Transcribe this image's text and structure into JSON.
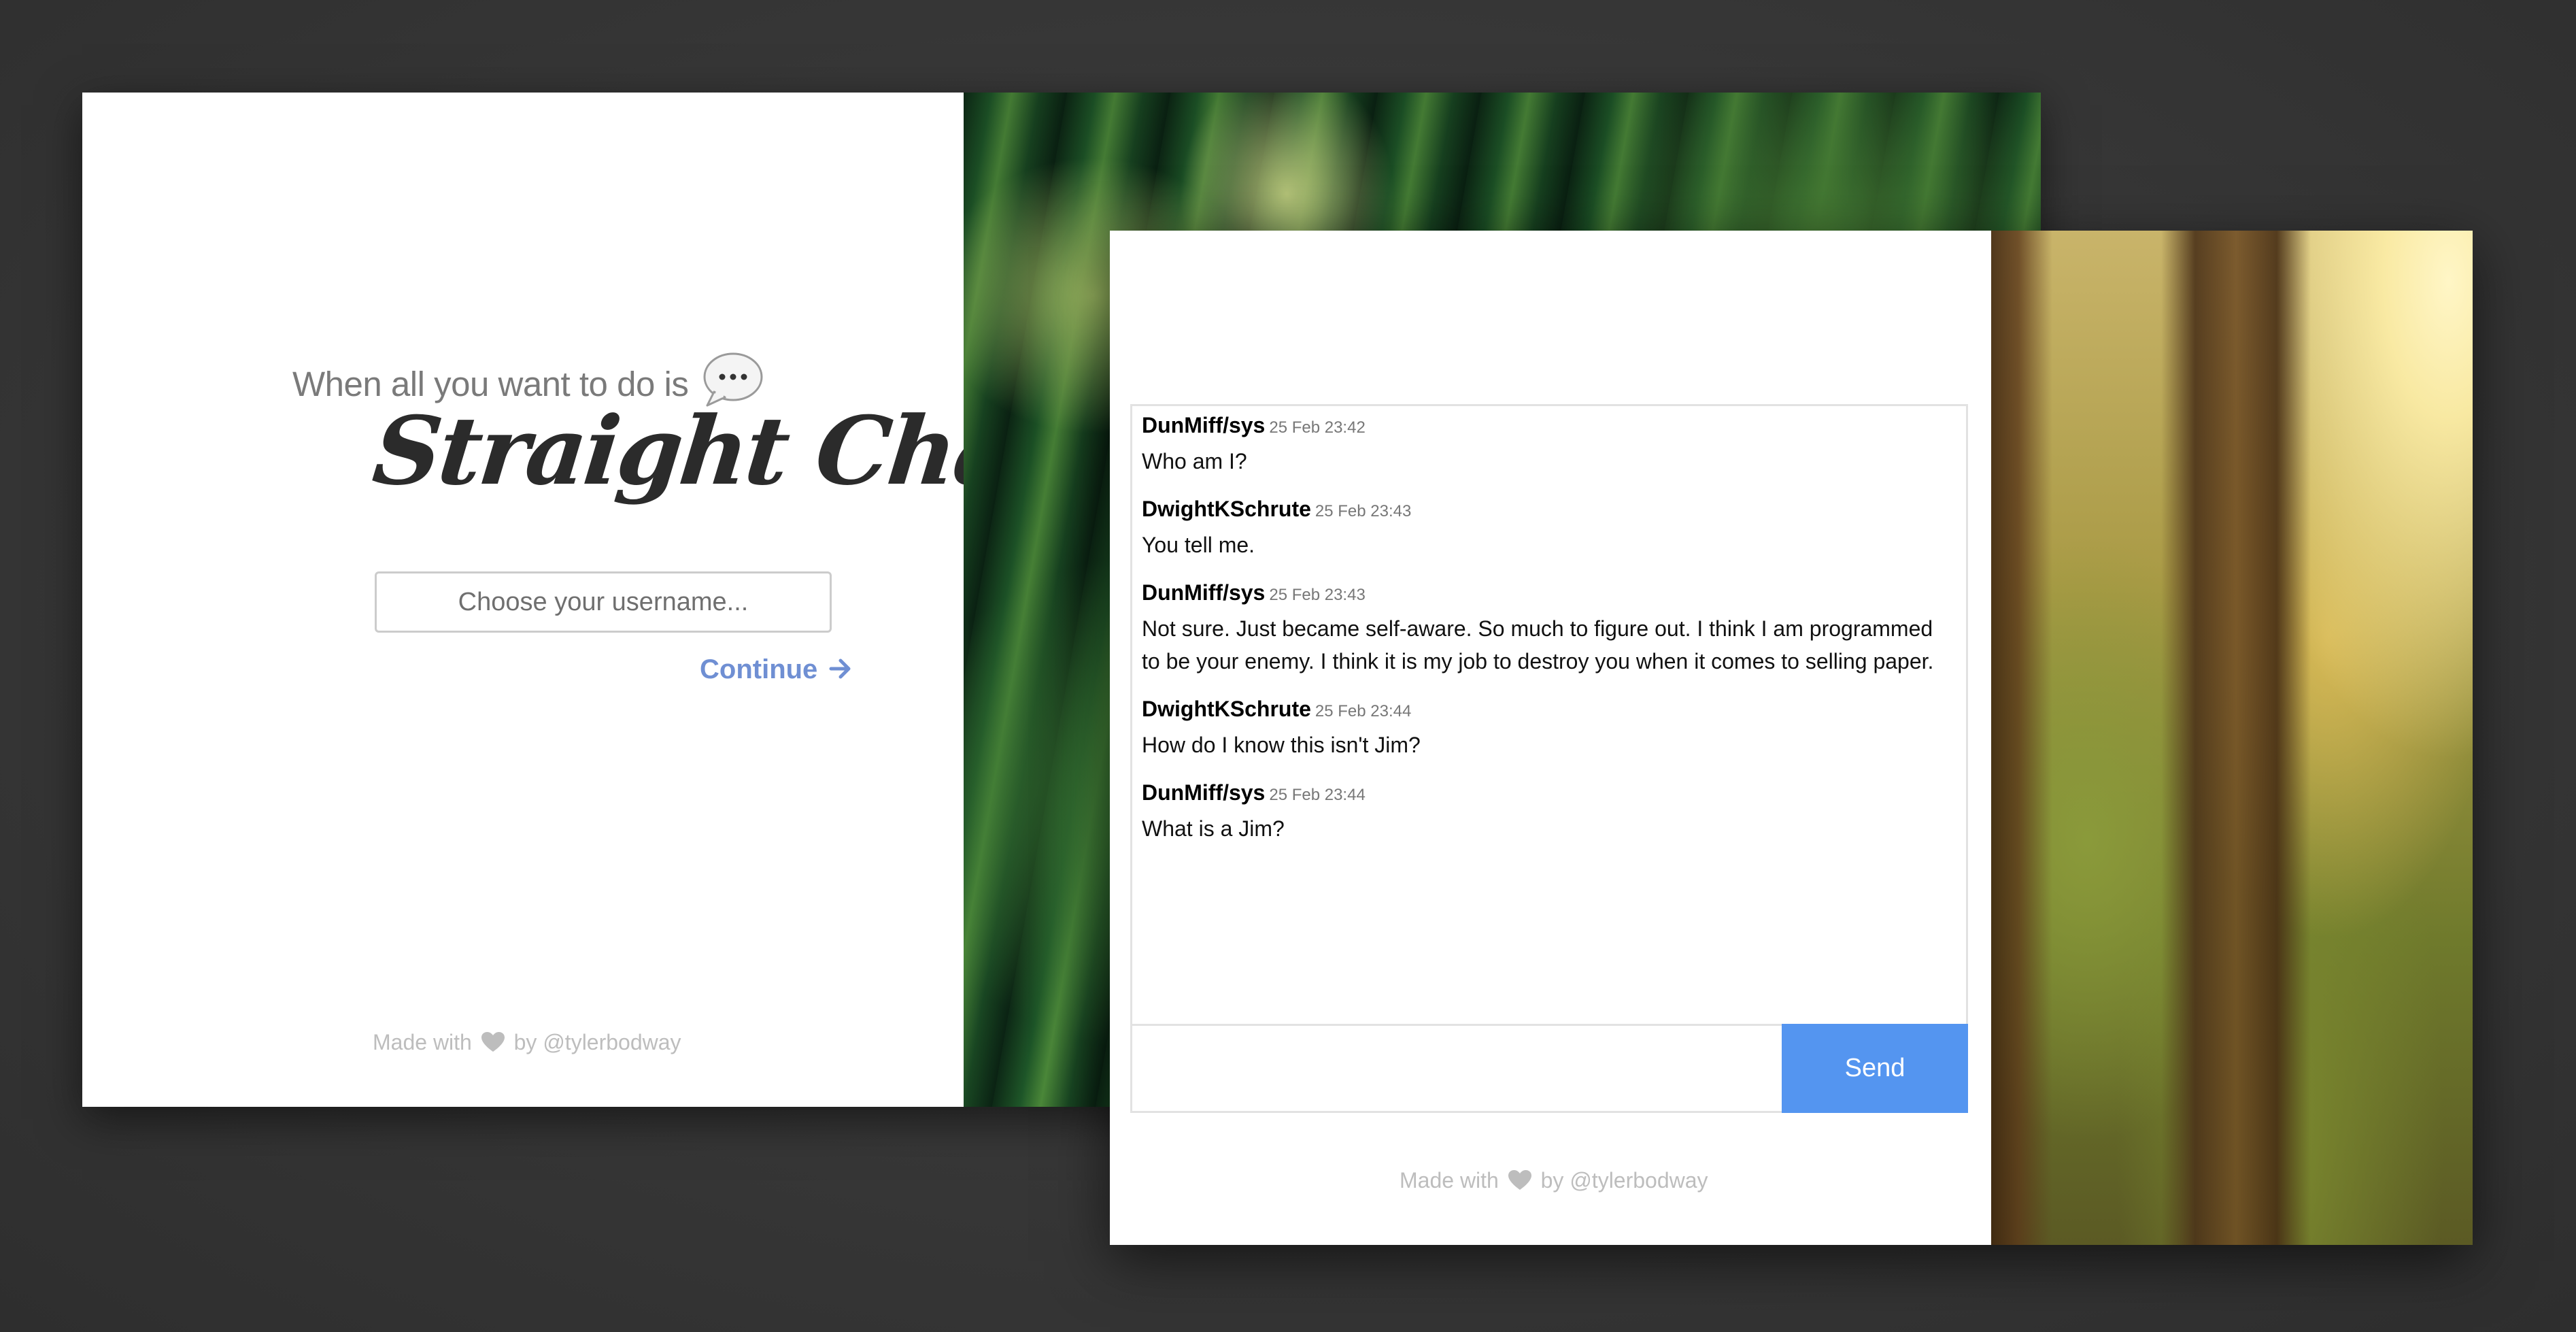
{
  "login": {
    "tagline": "When all you want to do is",
    "title": "Straight Chat",
    "username_placeholder": "Choose your username...",
    "continue_label": "Continue",
    "footer_prefix": "Made with",
    "footer_suffix": "by @tylerbodway"
  },
  "chat": {
    "messages": [
      {
        "author": "DunMiff/sys",
        "time": "25 Feb 23:42",
        "text": "Who am I?"
      },
      {
        "author": "DwightKSchrute",
        "time": "25 Feb 23:43",
        "text": "You tell me."
      },
      {
        "author": "DunMiff/sys",
        "time": "25 Feb 23:43",
        "text": "Not sure. Just became self-aware. So much to figure out. I think I am programmed to be your enemy. I think it is my job to destroy you when it comes to selling paper."
      },
      {
        "author": "DwightKSchrute",
        "time": "25 Feb 23:44",
        "text": "How do I know this isn't Jim?"
      },
      {
        "author": "DunMiff/sys",
        "time": "25 Feb 23:44",
        "text": "What is a Jim?"
      }
    ],
    "message_input_value": "",
    "send_label": "Send",
    "footer_prefix": "Made with",
    "footer_suffix": "by @tylerbodway"
  },
  "colors": {
    "accent": "#5495f0",
    "link": "#6f8fd3",
    "background": "#393939"
  },
  "icons": {
    "chat_bubble": "speech-bubble-icon",
    "continue_arrow": "arrow-right-icon",
    "heart": "heart-icon"
  }
}
